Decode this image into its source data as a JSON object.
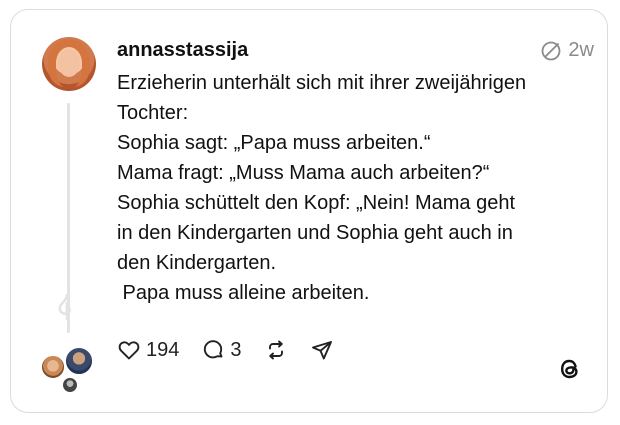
{
  "post": {
    "username": "annasstassija",
    "timestamp": "2w",
    "lines": [
      "Erzieherin unterhält sich mit ihrer zweijährigen",
      "Tochter:",
      "Sophia sagt: „Papa muss arbeiten.“",
      "Mama fragt: „Muss Mama auch arbeiten?“",
      "Sophia schüttelt den Kopf: „Nein! Mama geht",
      "in den Kindergarten und Sophia geht auch in",
      "den Kindergarten.",
      " Papa muss alleine arbeiten."
    ]
  },
  "actions": {
    "likes": "194",
    "replies": "3"
  },
  "icons": {
    "meta": "muted-slash-icon",
    "like": "heart-icon",
    "reply": "comment-icon",
    "repost": "repost-icon",
    "share": "send-icon",
    "brand": "threads-logo-icon"
  },
  "colors": {
    "border": "#dcdcdc",
    "text": "#111111",
    "muted": "#8a8a8a"
  }
}
